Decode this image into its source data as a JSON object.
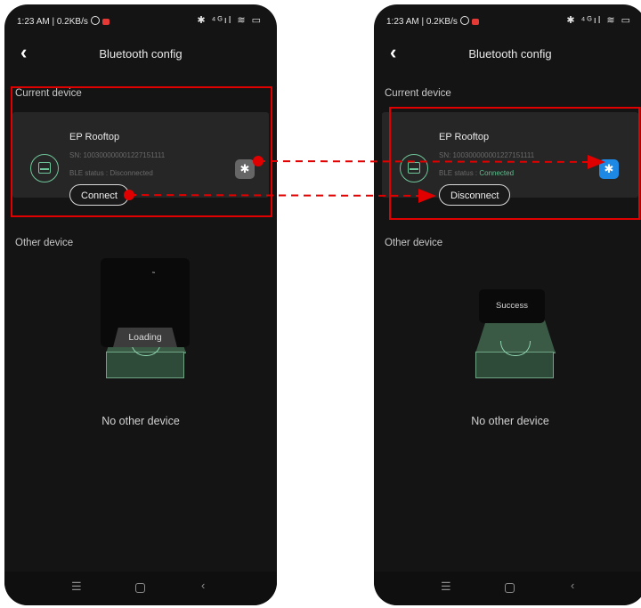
{
  "left_screen": {
    "status_bar": {
      "time_speed": "1:23 AM | 0.2KB/s",
      "right_icons": "✱ ⁴ᴳıl ≋ ▭"
    },
    "header": {
      "back_icon": "chevron-left-icon",
      "title": "Bluetooth config"
    },
    "current_label": "Current device",
    "device": {
      "name": "EP Rooftop",
      "sn": "SN: 100300000001227151111",
      "ble_label": "BLE status : ",
      "ble_status": "Disconnected",
      "bt_icon": "bluetooth-icon",
      "bt_glyph": "✱",
      "button_label": "Connect"
    },
    "other_label": "Other device",
    "loading_text": "Loading",
    "spinner": "˜",
    "empty_text": "No other device",
    "nav": {
      "menu": "☰",
      "back": "‹"
    }
  },
  "right_screen": {
    "status_bar": {
      "time_speed": "1:23 AM | 0.2KB/s",
      "right_icons": "✱ ⁴ᴳıl ≋ ▭"
    },
    "header": {
      "back_icon": "chevron-left-icon",
      "title": "Bluetooth config"
    },
    "current_label": "Current device",
    "device": {
      "name": "EP Rooftop",
      "sn": "SN: 100300000001227151111",
      "ble_label": "BLE status : ",
      "ble_status": "Connected",
      "bt_icon": "bluetooth-icon",
      "bt_glyph": "✱",
      "button_label": "Disconnect"
    },
    "other_label": "Other device",
    "toast_text": "Success",
    "empty_text": "No other device",
    "nav": {
      "menu": "☰",
      "back": "‹"
    }
  },
  "colors": {
    "highlight": "#e00000",
    "accent_green": "#5fbf8e",
    "bluetooth_on": "#1e88e5",
    "bluetooth_off": "#666666",
    "background": "#141414"
  }
}
